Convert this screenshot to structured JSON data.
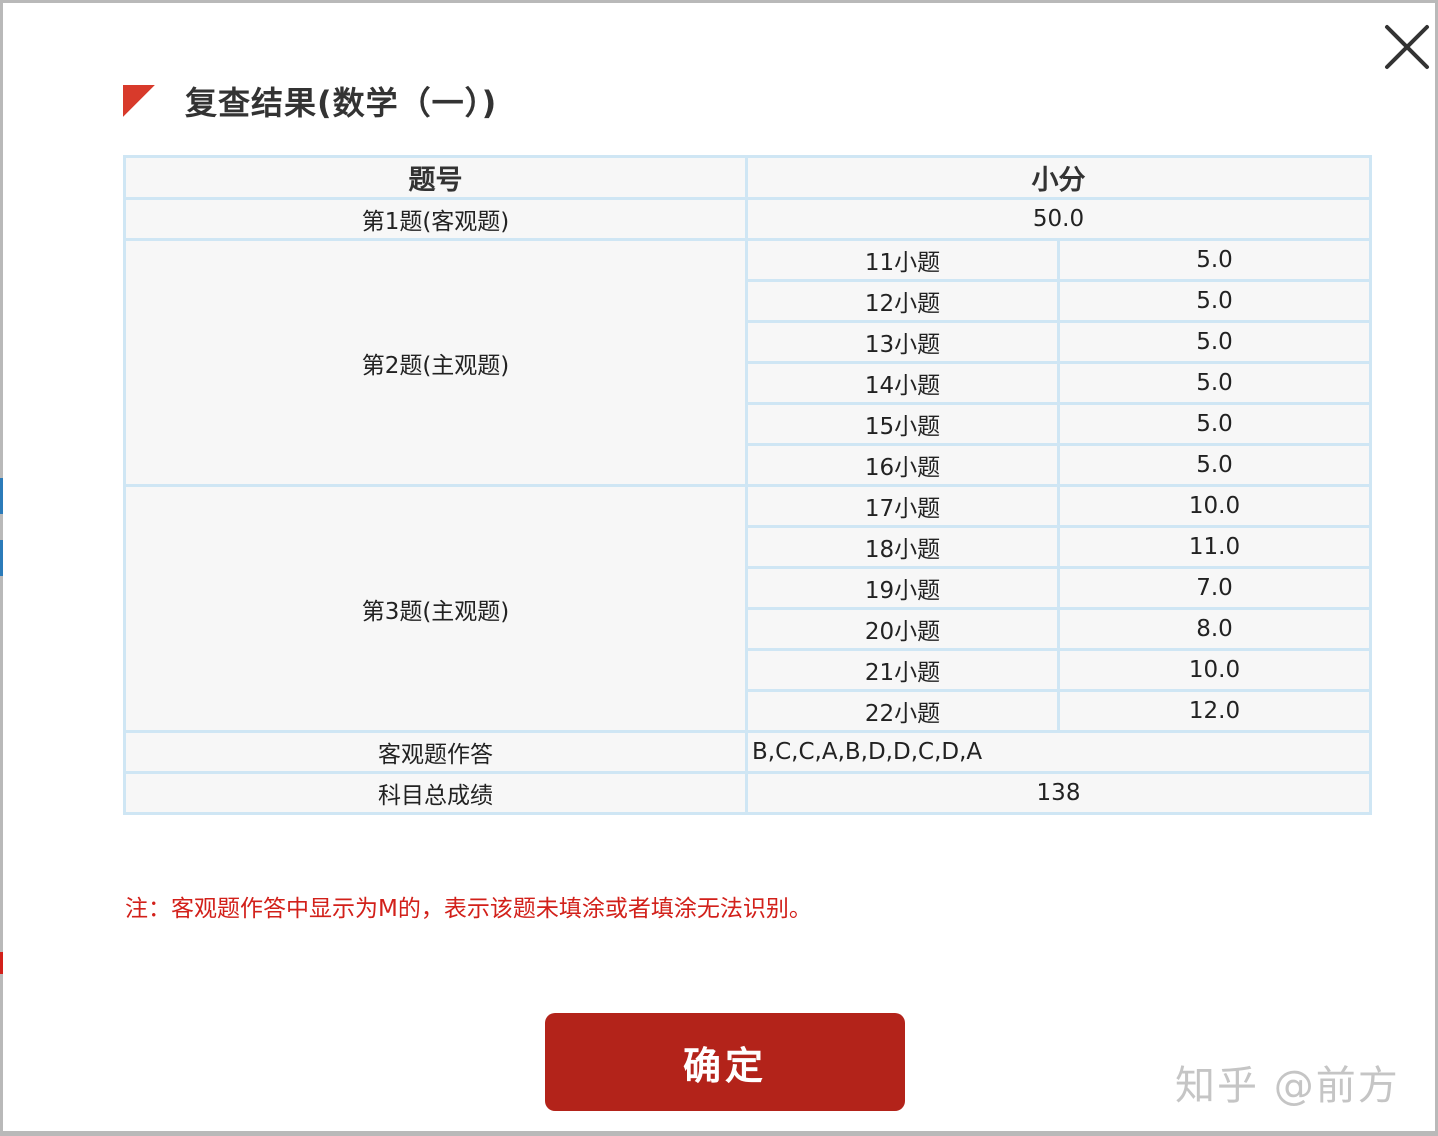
{
  "dialog": {
    "title": "复查结果(数学（一）)",
    "close_icon": "close-icon"
  },
  "table": {
    "headers": [
      "题号",
      "小分"
    ],
    "q1": {
      "label": "第1题(客观题)",
      "score": "50.0"
    },
    "q2": {
      "label": "第2题(主观题)",
      "rows": [
        {
          "item": "11小题",
          "score": "5.0"
        },
        {
          "item": "12小题",
          "score": "5.0"
        },
        {
          "item": "13小题",
          "score": "5.0"
        },
        {
          "item": "14小题",
          "score": "5.0"
        },
        {
          "item": "15小题",
          "score": "5.0"
        },
        {
          "item": "16小题",
          "score": "5.0"
        }
      ]
    },
    "q3": {
      "label": "第3题(主观题)",
      "rows": [
        {
          "item": "17小题",
          "score": "10.0"
        },
        {
          "item": "18小题",
          "score": "11.0"
        },
        {
          "item": "19小题",
          "score": "7.0"
        },
        {
          "item": "20小题",
          "score": "8.0"
        },
        {
          "item": "21小题",
          "score": "10.0"
        },
        {
          "item": "22小题",
          "score": "12.0"
        }
      ]
    },
    "objective_answers": {
      "label": "客观题作答",
      "value": "B,C,C,A,B,D,D,C,D,A"
    },
    "total": {
      "label": "科目总成绩",
      "value": "138"
    }
  },
  "note": "注：客观题作答中显示为M的，表示该题未填涂或者填涂无法识别。",
  "confirm_label": "确定",
  "watermark": "知乎 @前方",
  "colors": {
    "accent": "#b3231a",
    "note": "#d2201a",
    "table_border": "#cfe6f4",
    "cell_bg": "#f7f7f7",
    "flag": "#d83a2b"
  }
}
